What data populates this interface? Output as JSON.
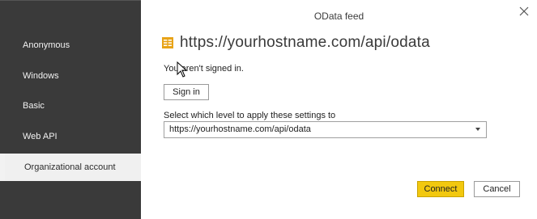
{
  "dialog": {
    "title": "OData feed",
    "close_icon": "close-icon",
    "url": "https://yourhostname.com/api/odata",
    "signed_status": "You aren't signed in.",
    "sign_in_label": "Sign in",
    "level_label": "Select which level to apply these settings to",
    "level_selected": "https://yourhostname.com/api/odata",
    "connect_label": "Connect",
    "cancel_label": "Cancel"
  },
  "sidebar": {
    "items": [
      {
        "label": "Anonymous",
        "active": false
      },
      {
        "label": "Windows",
        "active": false
      },
      {
        "label": "Basic",
        "active": false
      },
      {
        "label": "Web API",
        "active": false
      },
      {
        "label": "Organizational account",
        "active": true
      }
    ]
  },
  "colors": {
    "sidebar_bg": "#3a3a3a",
    "active_item_bg": "#f0f0f0",
    "primary_button": "#f2c80f",
    "feed_icon": "#e8a317"
  }
}
